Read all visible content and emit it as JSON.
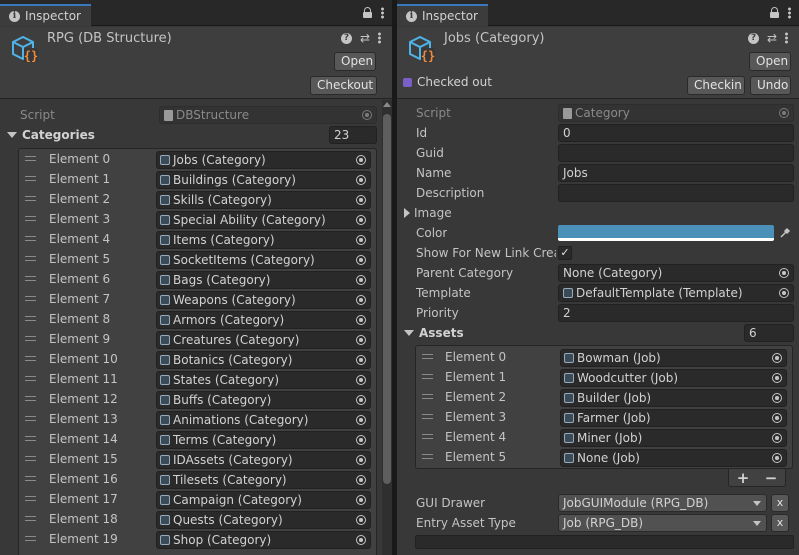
{
  "left": {
    "tab_title": "Inspector",
    "asset_title": "RPG (DB Structure)",
    "open_label": "Open",
    "checkout_label": "Checkout",
    "script_label": "Script",
    "script_value": "DBStructure",
    "list_label": "Categories",
    "list_count": "23",
    "elements": [
      {
        "label": "Element 0",
        "value": "Jobs (Category)"
      },
      {
        "label": "Element 1",
        "value": "Buildings (Category)"
      },
      {
        "label": "Element 2",
        "value": "Skills (Category)"
      },
      {
        "label": "Element 3",
        "value": "Special Ability (Category)"
      },
      {
        "label": "Element 4",
        "value": "Items (Category)"
      },
      {
        "label": "Element 5",
        "value": "SocketItems (Category)"
      },
      {
        "label": "Element 6",
        "value": "Bags (Category)"
      },
      {
        "label": "Element 7",
        "value": "Weapons (Category)"
      },
      {
        "label": "Element 8",
        "value": "Armors (Category)"
      },
      {
        "label": "Element 9",
        "value": "Creatures (Category)"
      },
      {
        "label": "Element 10",
        "value": "Botanics (Category)"
      },
      {
        "label": "Element 11",
        "value": "States (Category)"
      },
      {
        "label": "Element 12",
        "value": "Buffs (Category)"
      },
      {
        "label": "Element 13",
        "value": "Animations (Category)"
      },
      {
        "label": "Element 14",
        "value": "Terms (Category)"
      },
      {
        "label": "Element 15",
        "value": "IDAssets (Category)"
      },
      {
        "label": "Element 16",
        "value": "Tilesets (Category)"
      },
      {
        "label": "Element 17",
        "value": "Campaign (Category)"
      },
      {
        "label": "Element 18",
        "value": "Quests (Category)"
      },
      {
        "label": "Element 19",
        "value": "Shop (Category)"
      }
    ]
  },
  "right": {
    "tab_title": "Inspector",
    "asset_title": "Jobs (Category)",
    "open_label": "Open",
    "checked_out_text": "Checked out",
    "checkin_label": "Checkin",
    "undo_label": "Undo",
    "script_label": "Script",
    "script_value": "Category",
    "id_label": "Id",
    "id_value": "0",
    "guid_label": "Guid",
    "guid_value": "",
    "name_label": "Name",
    "name_value": "Jobs",
    "description_label": "Description",
    "description_value": "",
    "image_label": "Image",
    "color_label": "Color",
    "color_value": "#4b90b8",
    "show_label": "Show For New Link Crea",
    "show_checked": "✓",
    "parent_label": "Parent Category",
    "parent_value": "None (Category)",
    "template_label": "Template",
    "template_value": "DefaultTemplate (Template)",
    "priority_label": "Priority",
    "priority_value": "2",
    "assets_label": "Assets",
    "assets_count": "6",
    "assets": [
      {
        "label": "Element 0",
        "value": "Bowman (Job)"
      },
      {
        "label": "Element 1",
        "value": "Woodcutter (Job)"
      },
      {
        "label": "Element 2",
        "value": "Builder (Job)"
      },
      {
        "label": "Element 3",
        "value": "Farmer (Job)"
      },
      {
        "label": "Element 4",
        "value": "Miner (Job)"
      },
      {
        "label": "Element 5",
        "value": "None (Job)"
      }
    ],
    "plus": "+",
    "minus": "−",
    "gui_drawer_label": "GUI Drawer",
    "gui_drawer_value": "JobGUIModule (RPG_DB)",
    "entry_type_label": "Entry Asset Type",
    "entry_type_value": "Job (RPG_DB)",
    "clear_label": "x"
  }
}
